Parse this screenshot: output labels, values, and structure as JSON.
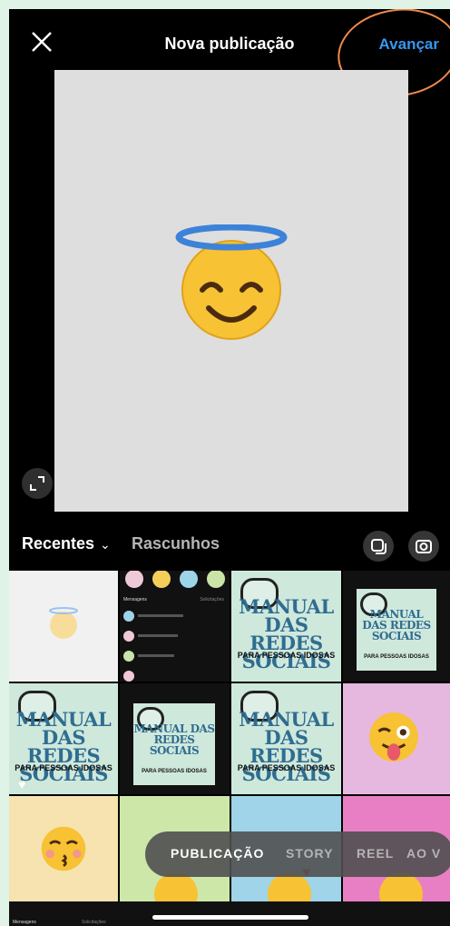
{
  "header": {
    "title": "Nova publicação",
    "next_label": "Avançar"
  },
  "gallery": {
    "recent_label": "Recentes",
    "drafts_label": "Rascunhos"
  },
  "grid_text": {
    "manual_title": "MANUAL DAS REDES SOCIAIS",
    "manual_subtitle": "PARA PESSOAS IDOSAS",
    "messages_label": "Mensagens",
    "requests_label": "Solicitações"
  },
  "mode_tabs": [
    {
      "label": "PUBLICAÇÃO",
      "active": true
    },
    {
      "label": "STORY",
      "active": false
    },
    {
      "label": "REEL",
      "active": false
    },
    {
      "label": "AO V",
      "active": false
    }
  ],
  "bottom_strip": {
    "messages": "Mensagens",
    "requests": "Solicitações"
  },
  "colors": {
    "accent": "#3897f0",
    "highlight_circle": "#f08a4b",
    "manual_title": "#2f6d90"
  },
  "icons": [
    "close-icon",
    "expand-icon",
    "multi-select-icon",
    "camera-icon",
    "chevron-down-icon"
  ]
}
